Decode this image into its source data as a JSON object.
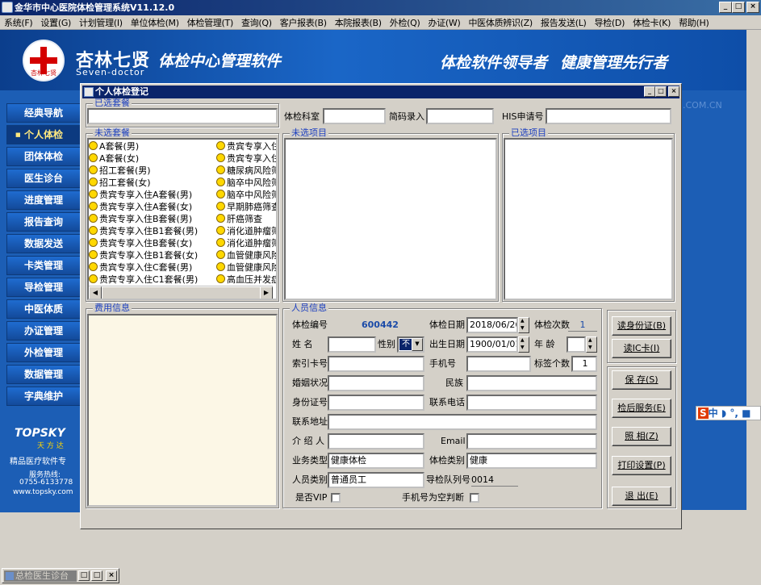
{
  "app": {
    "title": "金华市中心医院体检管理系统V11.12.0"
  },
  "menu": [
    "系统(F)",
    "设置(G)",
    "计划管理(I)",
    "单位体检(M)",
    "体检管理(T)",
    "查询(Q)",
    "客户报表(B)",
    "本院报表(B)",
    "外检(Q)",
    "办证(W)",
    "中医体质辨识(Z)",
    "报告发送(L)",
    "导检(D)",
    "体检卡(K)",
    "帮助(H)"
  ],
  "banner": {
    "brand": "杏林七贤",
    "brand_en": "Seven-doctor",
    "logo_sub": "杏林七贤",
    "product": "体检中心管理软件",
    "slogan1": "体检软件领导者",
    "slogan2": "健康管理先行者"
  },
  "nav": {
    "items": [
      "经典导航",
      "个人体检",
      "团体体检",
      "医生诊台",
      "进度管理",
      "报告查询",
      "数据发送",
      "卡类管理",
      "导检管理",
      "中医体质",
      "办证管理",
      "外检管理",
      "数据管理",
      "字典维护"
    ],
    "active": "个人体检"
  },
  "topsky": {
    "logo": "TOPSKY",
    "logo2": "天 方 达",
    "line1": "精品医疗软件专",
    "line2": "服务热线:",
    "line3": "0755-6133778",
    "line4": "www.topsky.com"
  },
  "watermark": ".COM.CN",
  "ime": {
    "s": "S",
    "text": "中 ◗ °, ■"
  },
  "bottom_window": {
    "title": "总检医生诊台"
  },
  "dialog": {
    "title": "个人体检登记",
    "selected_pkg_legend": "已选套餐",
    "dept_label": "体检科室",
    "quick_label": "简码录入",
    "his_label": "HIS申请号",
    "unselected_pkg_legend": "未选套餐",
    "unselected_items_legend": "未选项目",
    "selected_items_legend": "已选项目",
    "packages_col1": [
      "A套餐(男)",
      "A套餐(女)",
      "招工套餐(男)",
      "招工套餐(女)",
      "贵宾专享入住A套餐(男)",
      "贵宾专享入住A套餐(女)",
      "贵宾专享入住B套餐(男)",
      "贵宾专享入住B1套餐(男)",
      "贵宾专享入住B套餐(女)",
      "贵宾专享入住B1套餐(女)",
      "贵宾专享入住C套餐(男)",
      "贵宾专享入住C1套餐(男)"
    ],
    "packages_col2": [
      "贵宾专享入住",
      "贵宾专享入住",
      "糖尿病风险筛",
      "脑卒中风险筛",
      "脑卒中风险筛",
      "早期肺癌筛查",
      "肝癌筛查",
      "消化道肿瘤筛",
      "消化道肿瘤筛",
      "血管健康风险",
      "血管健康风险",
      "高血压并发症"
    ],
    "fee_legend": "费用信息",
    "person_legend": "人员信息",
    "exam_no_label": "体检编号",
    "exam_no": "600442",
    "exam_date_label": "体检日期",
    "exam_date": "2018/06/26",
    "exam_count_label": "体检次数",
    "exam_count": "1",
    "name_label": "姓    名",
    "gender_label": "性别",
    "gender_value": "不",
    "birth_label": "出生日期",
    "birth_date": "1900/01/01",
    "age_label": "年  龄",
    "card_label": "索引卡号",
    "mobile_label": "手机号",
    "labels_label": "标签个数",
    "labels_count": "1",
    "marital_label": "婚姻状况",
    "ethnic_label": "民族",
    "id_label": "身份证号",
    "phone_label": "联系电话",
    "address_label": "联系地址",
    "introducer_label": "介 绍 人",
    "email_label": "Email",
    "business_label": "业务类型",
    "business_value": "健康体检",
    "exam_type_label": "体检类别",
    "exam_type_value": "健康",
    "person_type_label": "人员类别",
    "person_type_value": "普通员工",
    "queue_label": "导检队列号",
    "queue_value": "0014",
    "vip_label": "是否VIP",
    "mobile_empty_label": "手机号为空判断",
    "buttons": {
      "read_id": "读身份证(B)",
      "read_ic": "读IC卡(I)",
      "save": "保 存(S)",
      "post_service": "检后服务(E)",
      "photo": "照 相(Z)",
      "print": "打印设置(P)",
      "exit": "退 出(E)"
    }
  }
}
